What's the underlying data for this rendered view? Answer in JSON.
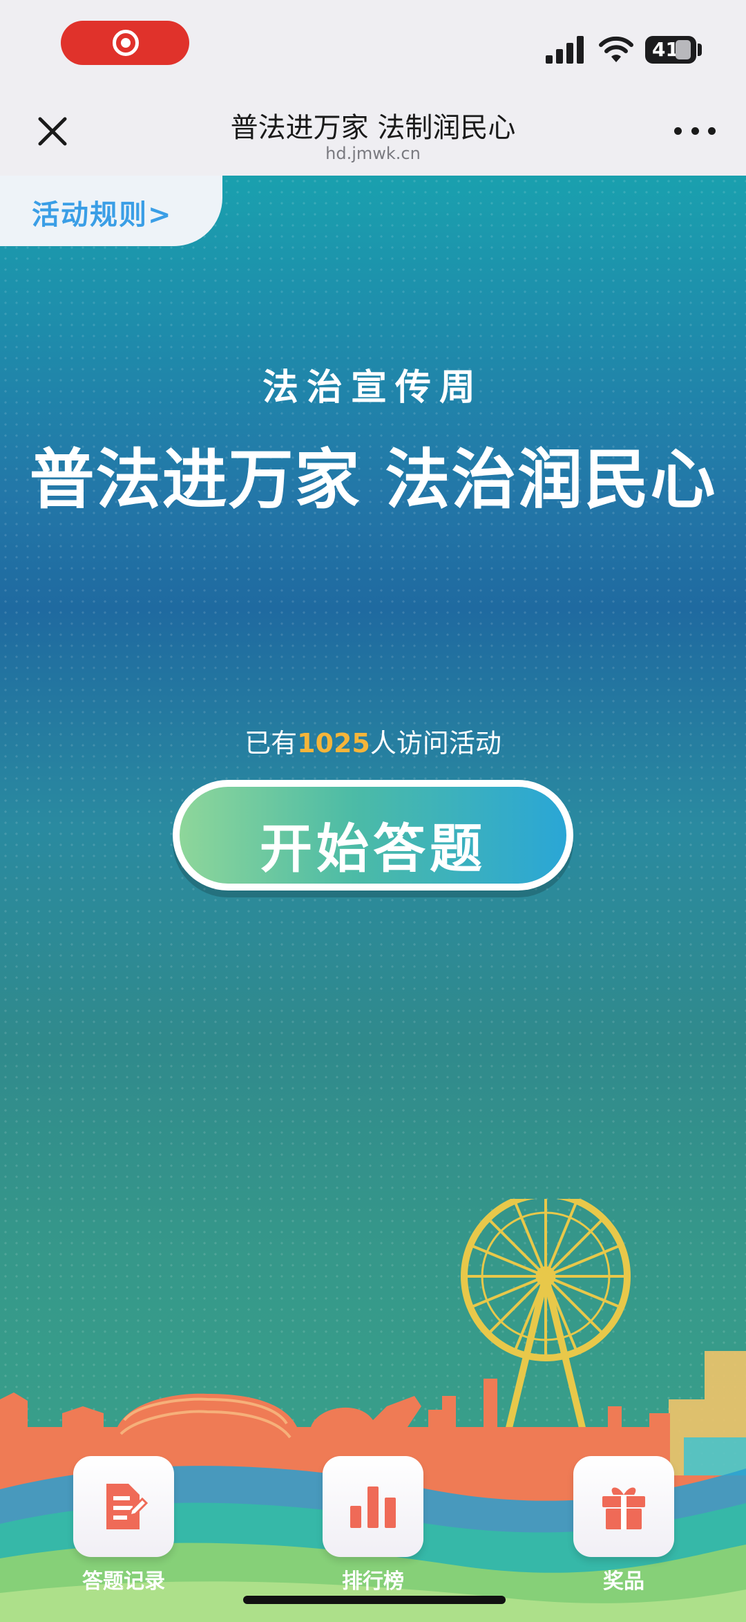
{
  "status_bar": {
    "battery": "41",
    "icons": [
      "screen-record-icon",
      "signal-icon",
      "wifi-icon",
      "battery-icon"
    ]
  },
  "nav": {
    "title": "普法进万家 法制润民心",
    "url": "hd.jmwk.cn",
    "icons": [
      "close-icon",
      "more-icon"
    ]
  },
  "page": {
    "rules_link": "活动规则>",
    "subtitle": "法治宣传周",
    "main_title": "普法进万家 法治润民心",
    "visits": {
      "prefix": "已有",
      "count": "1025",
      "suffix": "人访问活动"
    },
    "start_button": "开始答题"
  },
  "bottom_nav": [
    {
      "label": "答题记录",
      "icon": "answer-record-icon"
    },
    {
      "label": "排行榜",
      "icon": "leaderboard-icon"
    },
    {
      "label": "奖品",
      "icon": "gift-icon"
    }
  ],
  "colors": {
    "accent_count": "#f5b53a",
    "rules_text": "#3a9ee6",
    "icon_red": "#ef6a57",
    "record_pill": "#e0322b"
  }
}
